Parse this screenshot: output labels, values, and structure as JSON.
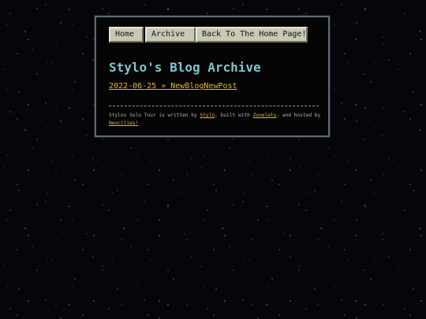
{
  "nav": {
    "home_label": "Home",
    "archive_label": "Archive",
    "back_label": "Back To The Home Page!"
  },
  "page": {
    "title": "Stylo's Blog Archive"
  },
  "entries": [
    {
      "label": "2022-06-25 » NewBlogNewPost"
    }
  ],
  "footer": {
    "prefix": "Stylos Solo Tour is written by ",
    "author_link": "Stylo",
    "middle": ", built with ",
    "builder_link": "Zonelets",
    "suffix": ", and hosted by ",
    "host_link": "Neocities!"
  },
  "colors": {
    "background": "#05050a",
    "panel": "#050505",
    "title": "#7ec6cf",
    "link": "#e8b43a",
    "button": "#c9c9b3"
  }
}
